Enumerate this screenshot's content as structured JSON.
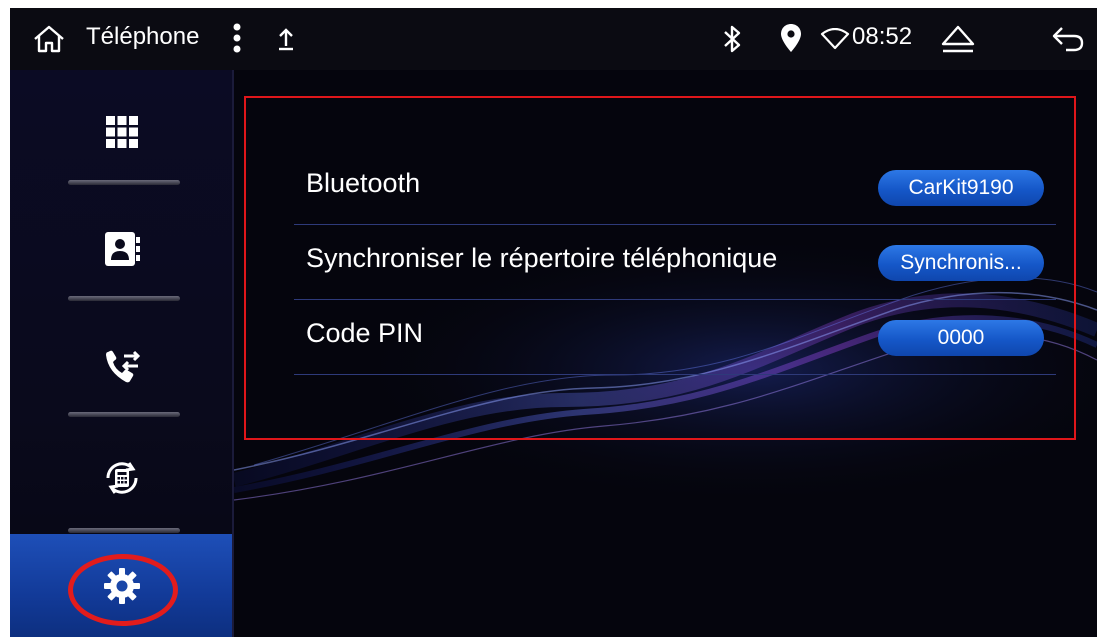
{
  "status_bar": {
    "title": "Téléphone",
    "time": "08:52",
    "icons": [
      "home-icon",
      "more-vert-icon",
      "upload-icon",
      "bluetooth-icon",
      "location-icon",
      "wifi-icon",
      "eject-icon",
      "back-icon"
    ]
  },
  "sidebar": {
    "items": [
      {
        "name": "dialpad",
        "icon": "dialpad-icon"
      },
      {
        "name": "contacts",
        "icon": "contacts-icon"
      },
      {
        "name": "call-log",
        "icon": "call-log-icon"
      },
      {
        "name": "phone-sync",
        "icon": "phone-sync-icon"
      },
      {
        "name": "settings",
        "icon": "gear-icon",
        "active": true
      }
    ]
  },
  "settings": {
    "rows": [
      {
        "label": "Bluetooth",
        "value": "CarKit9190"
      },
      {
        "label": "Synchroniser le répertoire téléphonique",
        "value": "Synchronis..."
      },
      {
        "label": "Code PIN",
        "value": "0000"
      }
    ]
  },
  "colors": {
    "accent": "#1557c8",
    "active_nav": "#1e4fb8",
    "highlight": "#e0161a",
    "background": "#04040a"
  }
}
